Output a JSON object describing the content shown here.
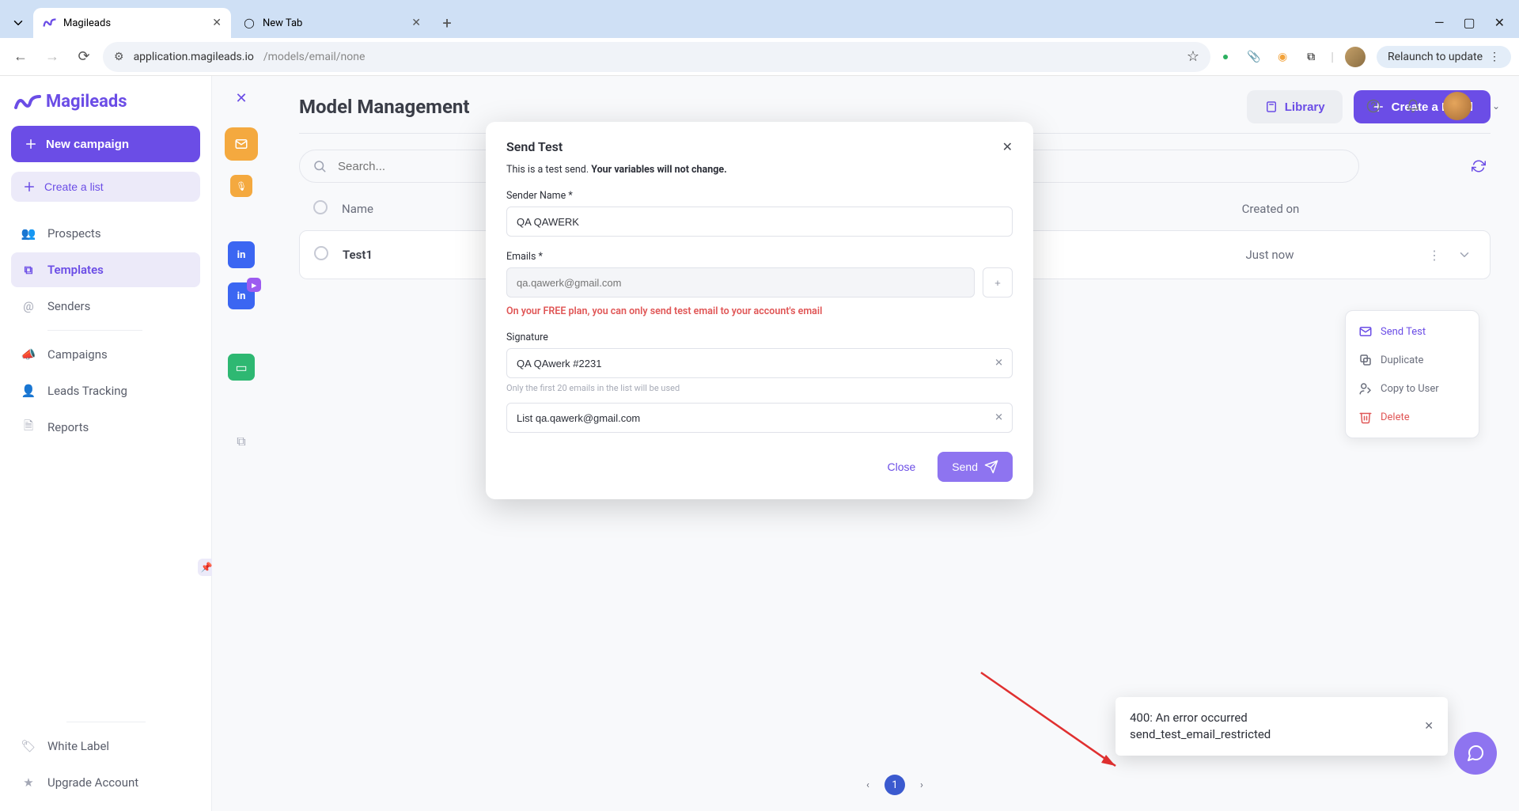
{
  "browser": {
    "tabs": [
      {
        "title": "Magileads"
      },
      {
        "title": "New Tab"
      }
    ],
    "url_dark": "application.magileads.io",
    "url_grey": "/models/email/none",
    "relaunch": "Relaunch to update"
  },
  "app": {
    "logo": "Magileads",
    "new_campaign": "New campaign",
    "create_list": "Create a list",
    "nav": {
      "prospects": "Prospects",
      "templates": "Templates",
      "senders": "Senders",
      "campaigns": "Campaigns",
      "leads": "Leads Tracking",
      "reports": "Reports",
      "white_label": "White Label",
      "upgrade": "Upgrade Account"
    }
  },
  "page": {
    "title": "Model Management",
    "library": "Library",
    "create": "Create a Email",
    "search_placeholder": "Search...",
    "col_name": "Name",
    "col_created": "Created on",
    "rows": [
      {
        "name": "Test1",
        "created": "Just now"
      }
    ],
    "page_current": "1"
  },
  "context_menu": {
    "send_test": "Send Test",
    "duplicate": "Duplicate",
    "copy_user": "Copy to User",
    "delete": "Delete"
  },
  "modal": {
    "title": "Send Test",
    "sub_a": "This is a test send.",
    "sub_b": "Your variables will not change.",
    "sender_label": "Sender Name *",
    "sender_value": "QA QAWERK",
    "emails_label": "Emails *",
    "emails_placeholder": "qa.qawerk@gmail.com",
    "warn": "On your FREE plan, you can only send test email to your account's email",
    "signature_label": "Signature",
    "signature_value": "QA QAwerk #2231",
    "hint": "Only the first 20 emails in the list will be used",
    "list_value": "List qa.qawerk@gmail.com",
    "close": "Close",
    "send": "Send"
  },
  "toast": {
    "line1": "400: An error occurred",
    "line2": "send_test_email_restricted"
  }
}
